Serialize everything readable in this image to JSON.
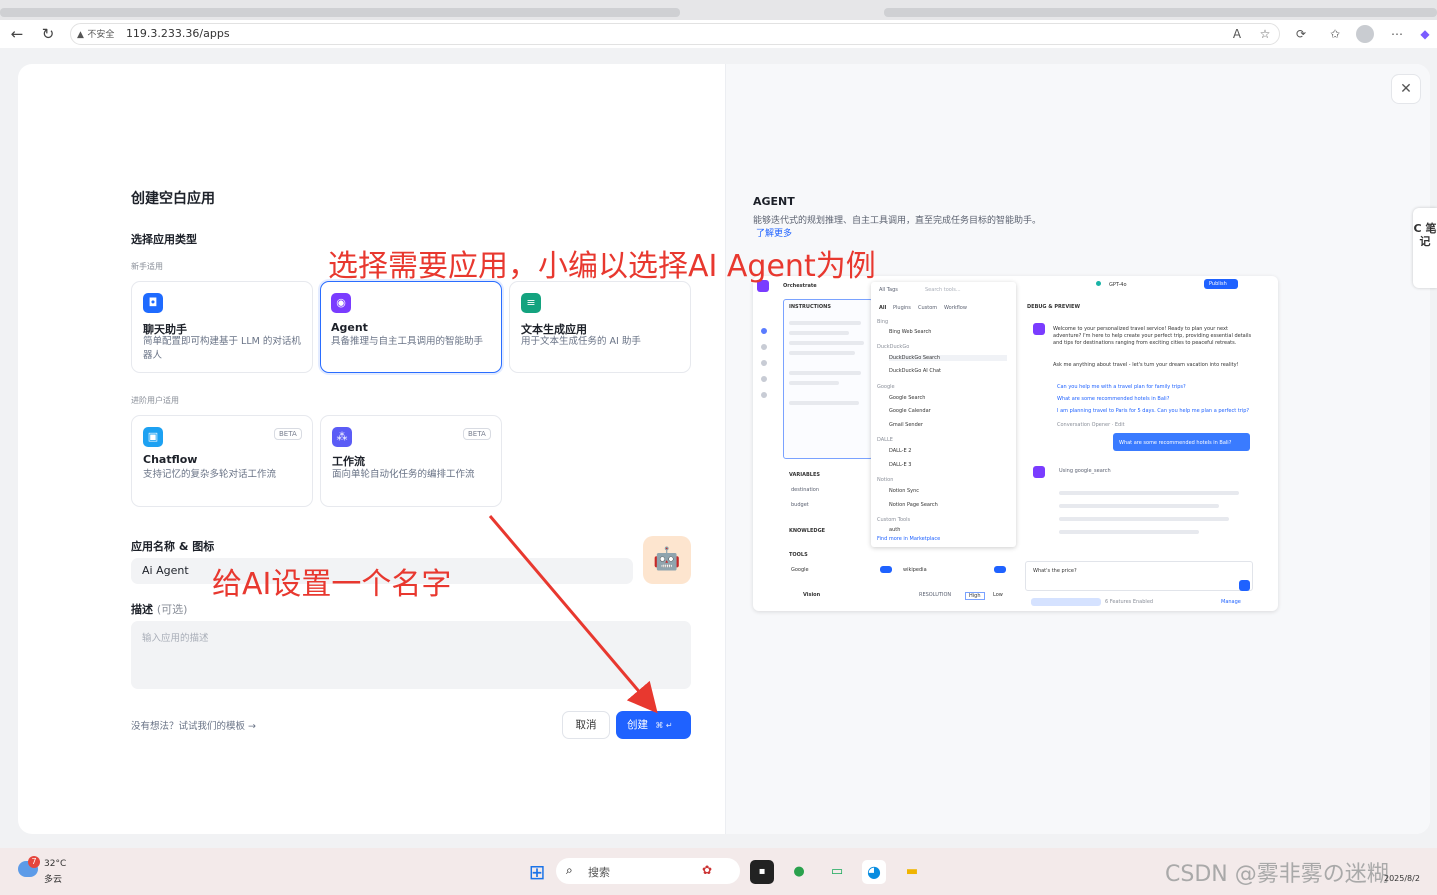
{
  "browser": {
    "insecure_label": "不安全",
    "url": "119.3.233.36/apps"
  },
  "modal": {
    "heading": "创建空白应用",
    "choose_type": "选择应用类型",
    "beginner_label": "新手适用",
    "advanced_label": "进阶用户适用",
    "types_beginner": [
      {
        "title": "聊天助手",
        "desc": "简单配置即可构建基于 LLM 的对话机器人",
        "color": "#1f6bff"
      },
      {
        "title": "Agent",
        "desc": "具备推理与自主工具调用的智能助手",
        "color": "#7a3cff"
      },
      {
        "title": "文本生成应用",
        "desc": "用于文本生成任务的 AI 助手",
        "color": "#14a37f"
      }
    ],
    "types_advanced": [
      {
        "title": "Chatflow",
        "desc": "支持记忆的复杂多轮对话工作流",
        "badge": "BETA",
        "color": "#1da1f2"
      },
      {
        "title": "工作流",
        "desc": "面向单轮自动化任务的编排工作流",
        "badge": "BETA",
        "color": "#5b5cf6"
      }
    ],
    "name_label": "应用名称 & 图标",
    "name_value": "Ai Agent",
    "desc_label": "描述",
    "desc_optional": "(可选)",
    "desc_placeholder": "输入应用的描述",
    "template_link": "没有想法？试试我们的模板",
    "cancel": "取消",
    "create": "创建",
    "create_shortcut": "⌘ ↵"
  },
  "right": {
    "title": "AGENT",
    "desc": "能够迭代式的规划推理、自主工具调用，直至完成任务目标的智能助手。",
    "learn_more": "了解更多",
    "preview": {
      "orchestrate": "Orchestrate",
      "instructions": "INSTRUCTIONS",
      "variables": "VARIABLES",
      "knowledge": "KNOWLEDGE",
      "tools": "TOOLS",
      "vision": "Vision",
      "debug": "DEBUG & PREVIEW",
      "publish": "Publish",
      "model": "GPT-4o",
      "all_tags": "All Tags",
      "search": "Search tools...",
      "tool_tabs": [
        "All",
        "Plugins",
        "Custom",
        "Workflow"
      ],
      "tool_groups": [
        {
          "group": "Bing",
          "items": [
            "Bing Web Search"
          ]
        },
        {
          "group": "DuckDuckGo",
          "items": [
            "DuckDuckGo Search",
            "DuckDuckGo AI Chat"
          ]
        },
        {
          "group": "Google",
          "items": [
            "Google Search",
            "Google Calendar",
            "Gmail Sender"
          ]
        },
        {
          "group": "DALLE",
          "items": [
            "DALL-E 2",
            "DALL-E 3"
          ]
        },
        {
          "group": "Notion",
          "items": [
            "Notion Sync",
            "Notion Page Search"
          ]
        },
        {
          "group": "Custom Tools",
          "items": [
            "auth"
          ]
        }
      ],
      "find_more": "Find more in Marketplace",
      "welcome": "Welcome to your personalized travel service! Ready to plan your next adventure? I'm here to help create your perfect trip, providing essential details and tips for destinations ranging from exciting cities to peaceful retreats.",
      "ask": "Ask me anything about travel - let's turn your dream vacation into reality!",
      "suggestions": [
        "Can you help me with a travel plan for family trips?",
        "What are some recommended hotels in Bali?",
        "I am planning travel to Paris for 5 days. Can you help me plan a perfect trip?"
      ],
      "opener": "Conversation Opener · Edit",
      "user_msg": "What are some recommended hotels in Bali?",
      "using": "Using google_search",
      "input": "What's the price?",
      "vars": [
        "destination",
        "budget"
      ],
      "tool_chips": [
        "Google",
        "wikipedia"
      ],
      "resolution": "RESOLUTION",
      "high": "High",
      "low": "Low",
      "features": "6 Features Enabled",
      "manage": "Manage"
    }
  },
  "annotations": {
    "top": "选择需要应用，小编以选择AI Agent为例",
    "name": "给AI设置一个名字"
  },
  "taskbar": {
    "weather_temp": "32°C",
    "weather_text": "多云",
    "weather_badge": "7",
    "search": "搜索",
    "watermark": "CSDN @雾非雾の迷糊",
    "clock": "2025/8/2"
  },
  "sidebar_note": "C 笔 记"
}
